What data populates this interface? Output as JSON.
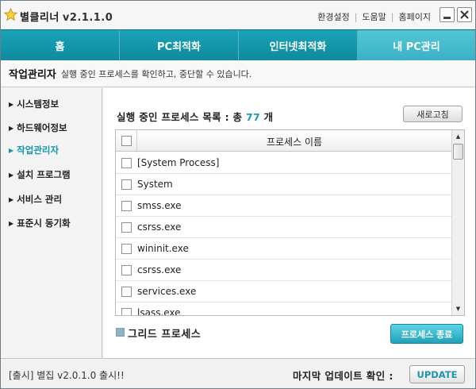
{
  "app": {
    "title": "별클리너",
    "version": "v2.1.1.0",
    "icon": "star-icon"
  },
  "top_links": [
    "환경설정",
    "도움말",
    "홈페이지"
  ],
  "window_controls": {
    "minimize": "minimize-icon",
    "close": "close-icon"
  },
  "tabs": [
    {
      "label": "홈",
      "active": false
    },
    {
      "label": "PC최적화",
      "active": false
    },
    {
      "label": "인터넷최적화",
      "active": false
    },
    {
      "label": "내 PC관리",
      "active": true
    }
  ],
  "section": {
    "title": "작업관리자",
    "description": "실행 중인 프로세스를 확인하고, 중단할 수 있습니다."
  },
  "sidebar": {
    "items": [
      {
        "label": "시스템정보",
        "active": false
      },
      {
        "label": "하드웨어정보",
        "active": false
      },
      {
        "label": "작업관리자",
        "active": true
      },
      {
        "label": "설치 프로그램",
        "active": false
      },
      {
        "label": "서비스 관리",
        "active": false
      },
      {
        "label": "표준시 동기화",
        "active": false
      }
    ]
  },
  "process_list": {
    "title_prefix": "실행 중인 프로세스 목록 : 총",
    "count": "77",
    "title_suffix": "개",
    "refresh_label": "새로고침",
    "column_header": "프로세스 이름",
    "rows": [
      "[System Process]",
      "System",
      "smss.exe",
      "csrss.exe",
      "wininit.exe",
      "csrss.exe",
      "services.exe",
      "lsass.exe"
    ]
  },
  "legend_label": "그리드 프로세스",
  "kill_button": "프로세스 종료",
  "footer": {
    "notice": "[출시] 별집 v2.0.1.0 출시!!",
    "update_label": "마지막 업데이트 확인 :",
    "update_button": "UPDATE"
  },
  "colors": {
    "accent": "#1a9bb3",
    "tab_bar": "#118ea1",
    "tab_active": "#3bb2c4",
    "legend_swatch": "#8fb3c6"
  }
}
